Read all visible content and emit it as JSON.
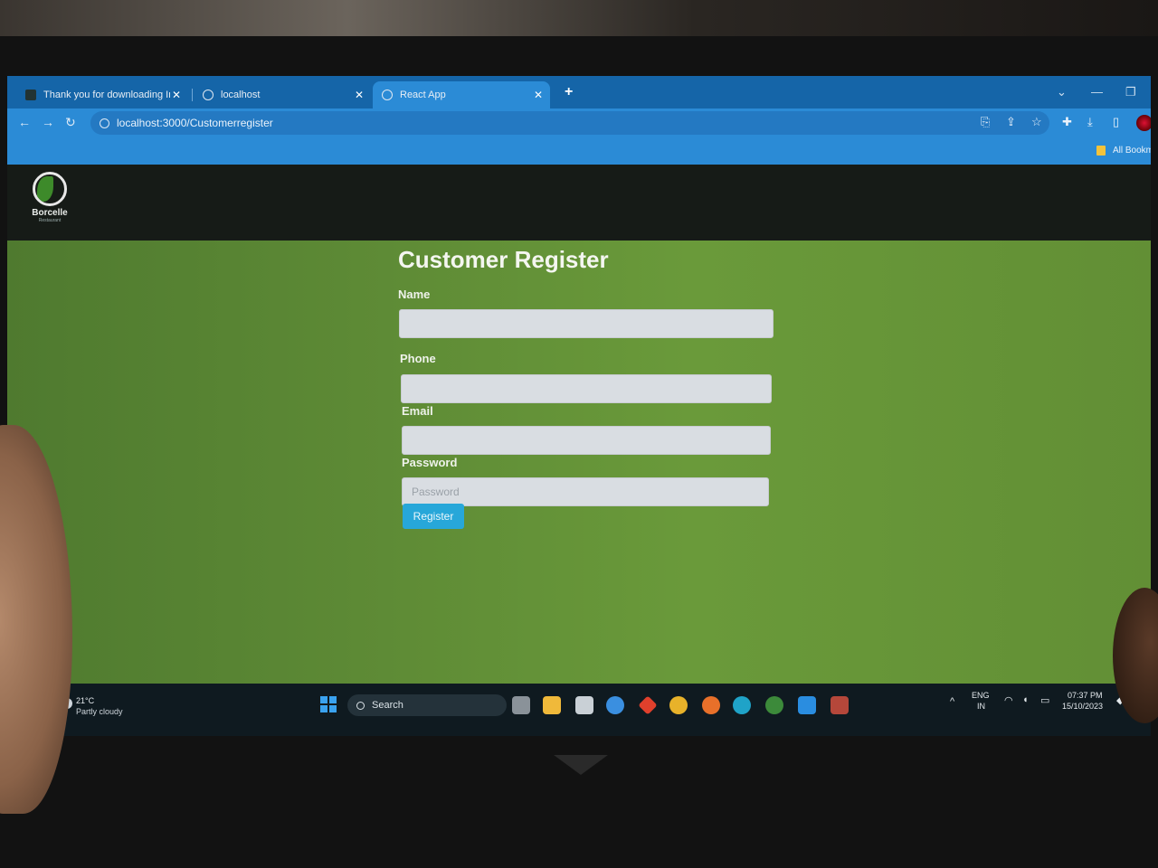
{
  "browser": {
    "tabs": [
      {
        "title": "Thank you for downloading Inte",
        "active": false
      },
      {
        "title": "localhost",
        "active": false
      },
      {
        "title": "React App",
        "active": true
      }
    ],
    "new_tab": "+",
    "url": "localhost:3000/Customerregister",
    "bookmarks_label": "All Bookma"
  },
  "app": {
    "brand_name": "Borcelle",
    "brand_sub": "Restaurant"
  },
  "form": {
    "title": "Customer Register",
    "name_label": "Name",
    "name_value": "",
    "phone_label": "Phone",
    "phone_value": "",
    "email_label": "Email",
    "email_value": "",
    "password_label": "Password",
    "password_placeholder": "Password",
    "register_label": "Register"
  },
  "taskbar": {
    "temperature": "21°C",
    "condition": "Partly cloudy",
    "search_label": "Search",
    "lang_top": "ENG",
    "lang_bottom": "IN",
    "time": "07:37 PM",
    "date": "15/10/2023"
  },
  "colors": {
    "page_bg": "#5f8c36",
    "browser_accent": "#2b8bd6",
    "register_button": "#27a7d9"
  }
}
